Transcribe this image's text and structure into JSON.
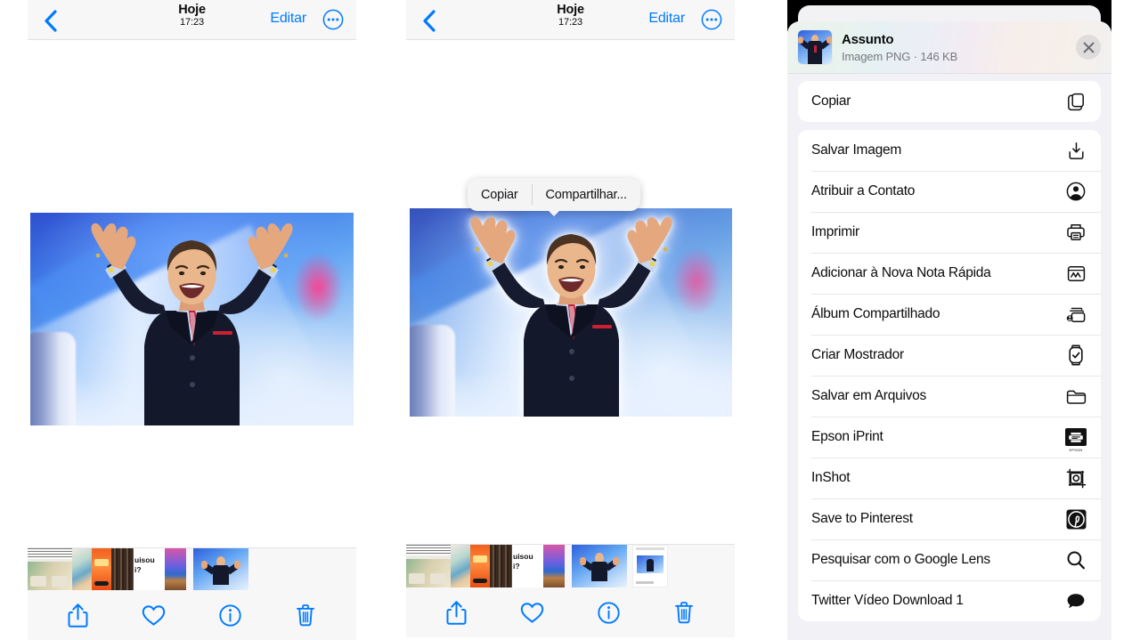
{
  "panels": {
    "photo_viewer": {
      "navbar": {
        "back_icon": "chevron-left-icon",
        "title": "Hoje",
        "time": "17:23",
        "edit_label": "Editar",
        "more_icon": "ellipsis-circle-icon"
      },
      "toolbar": {
        "share_icon": "share-icon",
        "favorite_icon": "heart-icon",
        "info_icon": "info-circle-icon",
        "delete_icon": "trash-icon"
      }
    },
    "photo_viewer_selection": {
      "callout": {
        "copy_label": "Copiar",
        "share_label": "Compartilhar..."
      }
    },
    "share_sheet": {
      "header": {
        "title": "Assunto",
        "subtitle": "Imagem PNG · 146 KB",
        "close_icon": "close-icon"
      },
      "groups": [
        {
          "items": [
            {
              "label": "Copiar",
              "icon": "copy-icon"
            }
          ]
        },
        {
          "items": [
            {
              "label": "Salvar Imagem",
              "icon": "save-download-icon"
            },
            {
              "label": "Atribuir a Contato",
              "icon": "contact-icon"
            },
            {
              "label": "Imprimir",
              "icon": "printer-icon"
            },
            {
              "label": "Adicionar à Nova Nota Rápida",
              "icon": "quick-note-icon"
            },
            {
              "label": "Álbum Compartilhado",
              "icon": "shared-album-icon"
            },
            {
              "label": "Criar Mostrador",
              "icon": "watch-face-icon"
            },
            {
              "label": "Salvar em Arquivos",
              "icon": "folder-icon"
            },
            {
              "label": "Epson iPrint",
              "icon": "epson-iprint-icon"
            },
            {
              "label": "InShot",
              "icon": "inshot-icon"
            },
            {
              "label": "Save to Pinterest",
              "icon": "pinterest-icon"
            },
            {
              "label": "Pesquisar com o Google Lens",
              "icon": "magnifier-icon"
            },
            {
              "label": "Twitter Vídeo Download 1",
              "icon": "speech-bubble-icon"
            }
          ]
        }
      ]
    }
  },
  "colors": {
    "ios_blue": "#007AFF",
    "navbar_bg": "#F7F7F8",
    "sheet_bg": "#F2F2F6",
    "row_bg": "#FFFFFF",
    "separator": "#E7E7EA",
    "secondary_text": "#78787E"
  }
}
